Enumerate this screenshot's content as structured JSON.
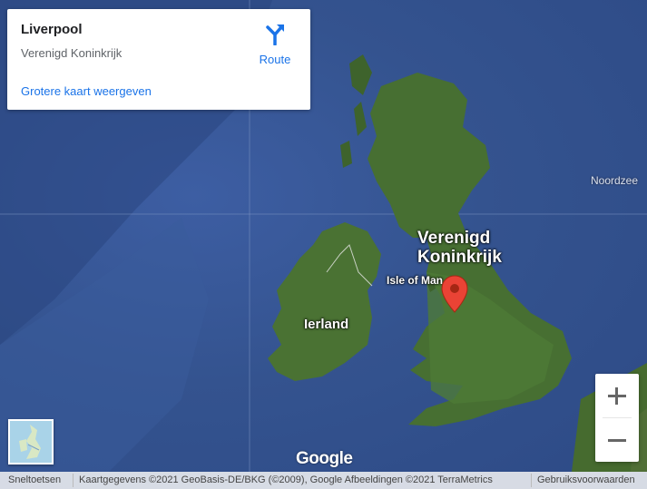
{
  "infocard": {
    "place": "Liverpool",
    "country": "Verenigd Koninkrijk",
    "route_label": "Route",
    "larger_map_link": "Grotere kaart weergeven"
  },
  "map_labels": {
    "uk_line1": "Verenigd",
    "uk_line2": "Koninkrijk",
    "ireland": "Ierland",
    "isle_of_man": "Isle of Man",
    "north_sea": "Noordzee"
  },
  "logo": "Google",
  "footer": {
    "shortcuts": "Sneltoetsen",
    "attribution": "Kaartgegevens ©2021 GeoBasis-DE/BKG (©2009), Google Afbeeldingen ©2021 TerraMetrics",
    "terms": "Gebruiksvoorwaarden"
  },
  "colors": {
    "link": "#1a73e8",
    "marker": "#ea4335",
    "sea": "#34538f",
    "land": "#3f6a2c"
  },
  "icons": {
    "route": "directions-icon",
    "marker": "location-pin-icon"
  }
}
